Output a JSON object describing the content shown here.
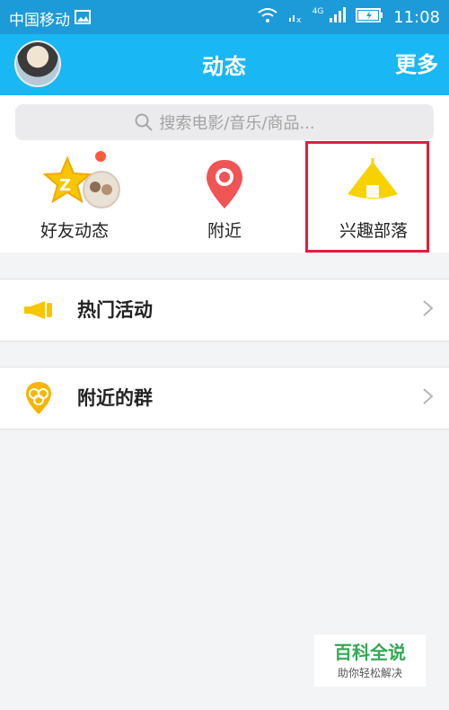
{
  "status_bar": {
    "carrier": "中国移动",
    "network": "4G",
    "time": "11:08"
  },
  "header": {
    "title": "动态",
    "more_label": "更多"
  },
  "search": {
    "placeholder": "搜索电影/音乐/商品..."
  },
  "entries": [
    {
      "label": "好友动态",
      "icon": "qzone-star-icon",
      "badge": true
    },
    {
      "label": "附近",
      "icon": "location-pin-icon"
    },
    {
      "label": "兴趣部落",
      "icon": "tent-icon",
      "highlighted": true
    }
  ],
  "list": [
    {
      "label": "热门活动",
      "icon": "megaphone-icon"
    },
    {
      "label": "附近的群",
      "icon": "nearby-group-icon"
    }
  ],
  "watermark": {
    "title": "百科全说",
    "subtitle": "助你轻松解决"
  },
  "colors": {
    "header": "#1ab7f5",
    "statusbar": "#1d9ad8",
    "highlight": "#e21d3d",
    "badge": "#ff5a3c",
    "pin": "#f05454",
    "tent": "#f7d200",
    "watermark": "#34a853"
  }
}
